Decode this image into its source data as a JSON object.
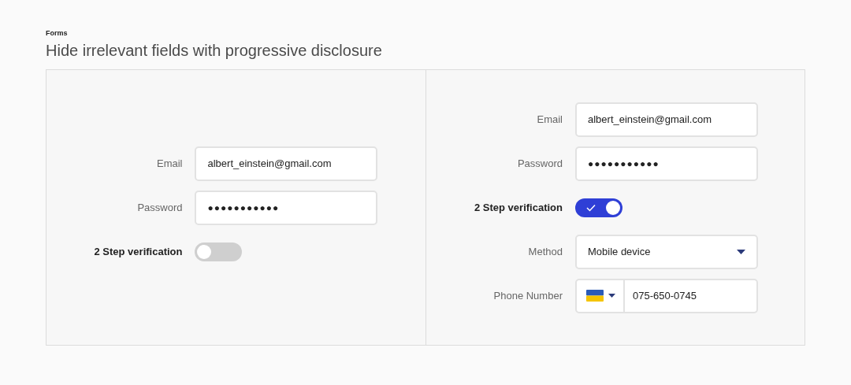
{
  "eyebrow": "Forms",
  "title": "Hide irrelevant fields with progressive disclosure",
  "panels": [
    {
      "fields": [
        {
          "kind": "text",
          "label": "Email",
          "value": "albert_einstein@gmail.com"
        },
        {
          "kind": "password",
          "label": "Password",
          "value": "●●●●●●●●●●●"
        },
        {
          "kind": "toggle",
          "label": "2 Step verification",
          "on": false
        }
      ]
    },
    {
      "fields": [
        {
          "kind": "text",
          "label": "Email",
          "value": "albert_einstein@gmail.com"
        },
        {
          "kind": "password",
          "label": "Password",
          "value": "●●●●●●●●●●●"
        },
        {
          "kind": "toggle",
          "label": "2 Step verification",
          "on": true
        },
        {
          "kind": "select",
          "label": "Method",
          "value": "Mobile device"
        },
        {
          "kind": "phone",
          "label": "Phone Number",
          "value": "075-650-0745"
        }
      ]
    }
  ]
}
